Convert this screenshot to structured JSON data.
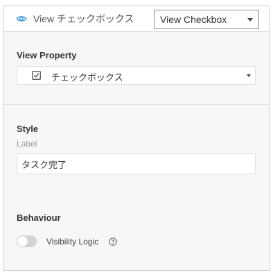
{
  "header": {
    "title": "View チェックボックス",
    "view_select": {
      "selected": "View Checkbox"
    },
    "icons": {
      "eye": "eye-icon",
      "caret": "chevron-down-icon"
    },
    "accent_color": "#3a9ad9"
  },
  "view_property": {
    "heading": "View Property",
    "select": {
      "selected": "チェックボックス",
      "icon": "checkbox-icon"
    }
  },
  "style": {
    "heading": "Style",
    "label_caption": "Label",
    "label_value": "タスク完了"
  },
  "behaviour": {
    "heading": "Behaviour",
    "visibility_logic": {
      "label": "Visibility Logic",
      "enabled": false,
      "help_icon": "question-circle-icon"
    }
  }
}
